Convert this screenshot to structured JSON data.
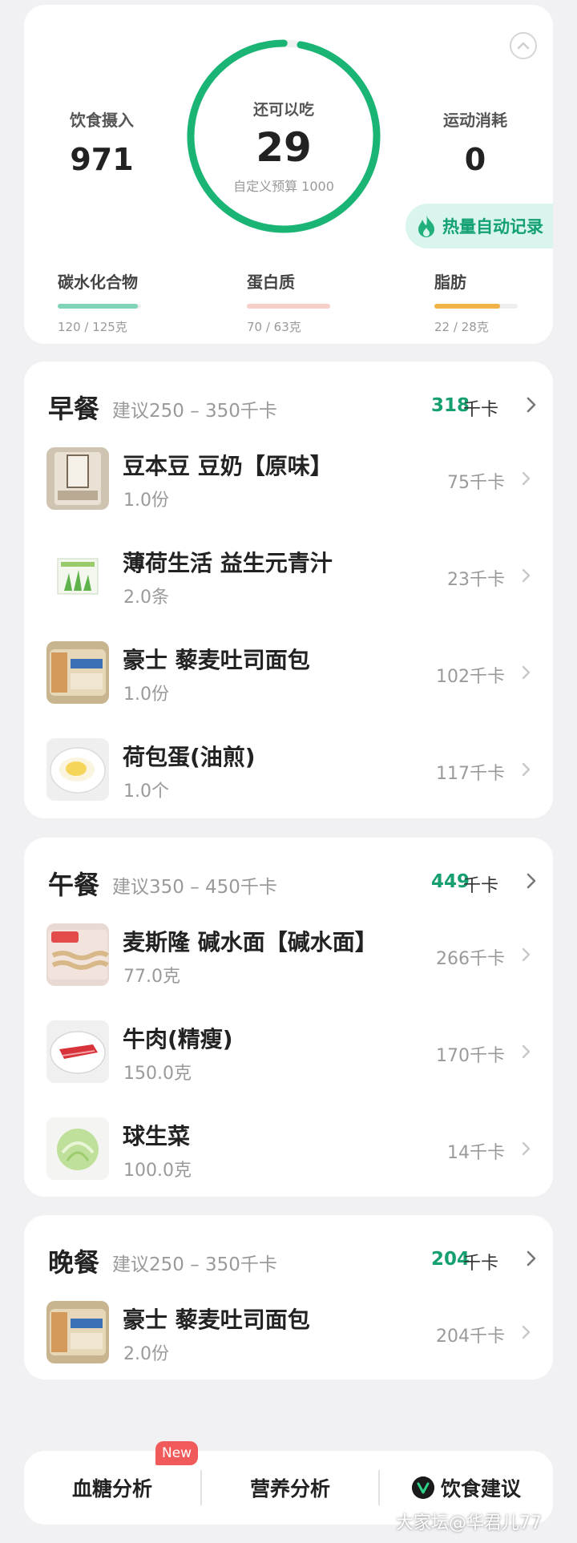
{
  "summary": {
    "intake_label": "饮食摄入",
    "intake_value": "971",
    "remaining_label": "还可以吃",
    "remaining_value": "29",
    "budget_text": "自定义预算 1000",
    "remaining_fraction": 0.971,
    "exercise_label": "运动消耗",
    "exercise_value": "0",
    "auto_record_label": "热量自动记录",
    "ring_color": "#1ab574",
    "macros": [
      {
        "name": "碳水化合物",
        "value": "120 / 125克",
        "fraction": 0.96,
        "color": "#7fd4b7"
      },
      {
        "name": "蛋白质",
        "value": "70 / 63克",
        "fraction": 1.0,
        "color": "#f6cfc6"
      },
      {
        "name": "脂肪",
        "value": "22 / 28克",
        "fraction": 0.79,
        "color": "#f0b347"
      }
    ]
  },
  "meals": {
    "breakfast": {
      "title": "早餐",
      "suggest": "建议250 – 350千卡",
      "kcal": "318",
      "unit": "千卡",
      "items": [
        {
          "name": "豆本豆 豆奶【原味】",
          "qty": "1.0份",
          "kcal": "75千卡"
        },
        {
          "name": "薄荷生活 益生元青汁",
          "qty": "2.0条",
          "kcal": "23千卡"
        },
        {
          "name": "豪士 藜麦吐司面包",
          "qty": "1.0份",
          "kcal": "102千卡"
        },
        {
          "name": "荷包蛋(油煎)",
          "qty": "1.0个",
          "kcal": "117千卡"
        }
      ]
    },
    "lunch": {
      "title": "午餐",
      "suggest": "建议350 – 450千卡",
      "kcal": "449",
      "unit": "千卡",
      "items": [
        {
          "name": "麦斯隆 碱水面【碱水面】",
          "qty": "77.0克",
          "kcal": "266千卡"
        },
        {
          "name": "牛肉(精瘦)",
          "qty": "150.0克",
          "kcal": "170千卡"
        },
        {
          "name": "球生菜",
          "qty": "100.0克",
          "kcal": "14千卡"
        }
      ]
    },
    "dinner": {
      "title": "晚餐",
      "suggest": "建议250 – 350千卡",
      "kcal": "204",
      "unit": "千卡",
      "items": [
        {
          "name": "豪士 藜麦吐司面包",
          "qty": "2.0份",
          "kcal": "204千卡"
        }
      ]
    }
  },
  "bottom_bar": {
    "glucose": "血糖分析",
    "new_badge": "New",
    "nutrition": "营养分析",
    "diet": "饮食建议"
  },
  "watermark": "大家坛@华君儿77"
}
